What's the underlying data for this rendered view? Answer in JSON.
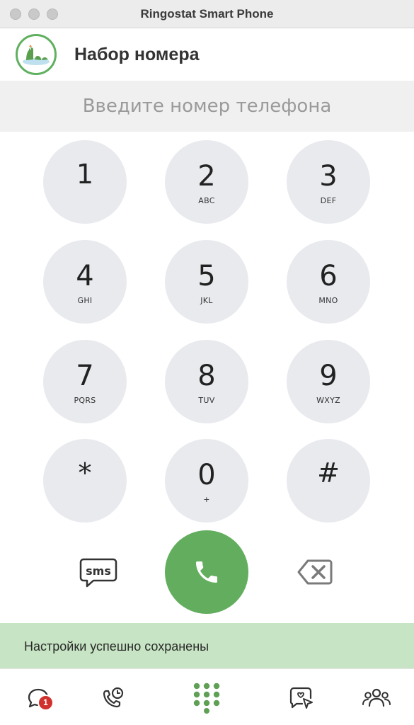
{
  "window": {
    "title": "Ringostat Smart Phone"
  },
  "header": {
    "title": "Набор номера",
    "avatar_icon": "dragon-avatar-icon"
  },
  "dialer": {
    "placeholder": "Введите номер телефона",
    "value": "",
    "keys": [
      {
        "digit": "1",
        "letters": ""
      },
      {
        "digit": "2",
        "letters": "ABC"
      },
      {
        "digit": "3",
        "letters": "DEF"
      },
      {
        "digit": "4",
        "letters": "GHI"
      },
      {
        "digit": "5",
        "letters": "JKL"
      },
      {
        "digit": "6",
        "letters": "MNO"
      },
      {
        "digit": "7",
        "letters": "PQRS"
      },
      {
        "digit": "8",
        "letters": "TUV"
      },
      {
        "digit": "9",
        "letters": "WXYZ"
      },
      {
        "digit": "*",
        "letters": ""
      },
      {
        "digit": "0",
        "letters": "+"
      },
      {
        "digit": "#",
        "letters": ""
      }
    ]
  },
  "actions": {
    "sms_label": "sms",
    "call_icon": "phone-icon",
    "backspace_icon": "backspace-icon",
    "call_color": "#63ad5e"
  },
  "toast": {
    "message": "Настройки успешно сохранены",
    "color": "#c7e5c4"
  },
  "nav": {
    "items": [
      {
        "icon": "chat-bubble-icon",
        "badge": "1"
      },
      {
        "icon": "call-history-icon"
      },
      {
        "icon": "dialpad-icon"
      },
      {
        "icon": "message-pointer-icon"
      },
      {
        "icon": "contacts-icon"
      }
    ],
    "accent": "#5fa055"
  }
}
